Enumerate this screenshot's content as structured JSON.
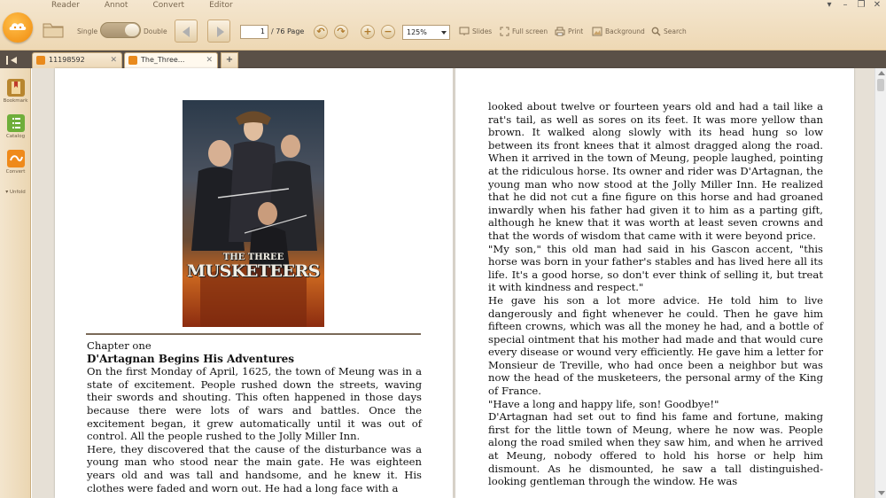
{
  "menu": [
    "Reader",
    "Annot",
    "Convert",
    "Editor"
  ],
  "window_controls": {
    "menu": "▾",
    "minimize": "–",
    "restore": "❐",
    "close": "✕"
  },
  "view_mode": {
    "single_label": "Single",
    "double_label": "Double"
  },
  "navigation": {
    "current_page": "1",
    "total_label": "/ 76 Page"
  },
  "zoom": {
    "value": "125%"
  },
  "tools": {
    "slides": "Slides",
    "fullscreen": "Full screen",
    "print": "Print",
    "background": "Background",
    "search": "Search"
  },
  "tabs": [
    {
      "label": "11198592",
      "close": "✕"
    },
    {
      "label": "The_Three...",
      "close": "✕"
    }
  ],
  "tab_add": "+",
  "sidebar": {
    "bookmark": "Bookmark",
    "catalog": "Catalog",
    "convert": "Convert",
    "unfold": "Unfold"
  },
  "cover": {
    "line1": "THE THREE",
    "line2": "MUSKETEERS"
  },
  "left_page": {
    "chapter_label": "Chapter one",
    "chapter_title": "D'Artagnan Begins His Adventures",
    "paragraph1": "On the first Monday of April, 1625, the town of Meung was in a state of excitement. People rushed down the streets, waving their swords and shouting. This often happened in those days because there were lots of wars and battles. Once the excitement began, it grew automatically until it was out of control. All the people rushed to the Jolly Miller Inn.",
    "paragraph2": "Here, they discovered that the cause of the disturbance was a young man who stood near the main gate. He was eighteen years old and was tall and handsome, and he knew it. His clothes were faded and worn out. He had a long face with a"
  },
  "right_page": {
    "paragraph1": "looked about twelve or fourteen years old and had a tail like a rat's tail, as well as sores on its feet. It was more yellow than brown. It walked along slowly with its head hung so low between its front knees that it almost dragged along the road. When it arrived in the town of Meung, people laughed, pointing at the ridiculous horse. Its owner and rider was D'Artagnan, the young man who now stood at the Jolly Miller Inn. He realized that he did not cut a fine figure on this horse and had groaned inwardly when his father had given it to him as a parting gift, although he knew that it was worth at least seven crowns and that the words of wisdom that came with it were beyond price.",
    "paragraph2": "\"My son,\" this old man had said in his Gascon accent, \"this horse was born in your father's stables and has lived here all its life. It's a good horse, so don't ever think of selling it, but treat it with kindness and respect.\"",
    "paragraph3": "He gave his son a lot more advice. He told him to live dangerously and fight whenever he could. Then he gave him fifteen crowns, which was all the money he had, and a bottle of special ointment that his mother had made and that would cure every disease or wound very efficiently. He gave him a letter for Monsieur de Treville, who had once been a neighbor but was now the head of the musketeers, the personal army of the King of France.",
    "paragraph4": "\"Have a long and happy life, son! Goodbye!\"",
    "paragraph5": "D'Artagnan had set out to find his fame and fortune, making first for the little town of Meung, where he now was. People along the road smiled when they saw him, and when he arrived at Meung, nobody offered to hold his horse or help him dismount. As he dismounted, he saw a tall distinguished-looking gentleman through the window. He was"
  },
  "colors": {
    "accent": "#f08a0c",
    "toolbar": "#f4e6cf",
    "tabbar": "#5a5047"
  }
}
